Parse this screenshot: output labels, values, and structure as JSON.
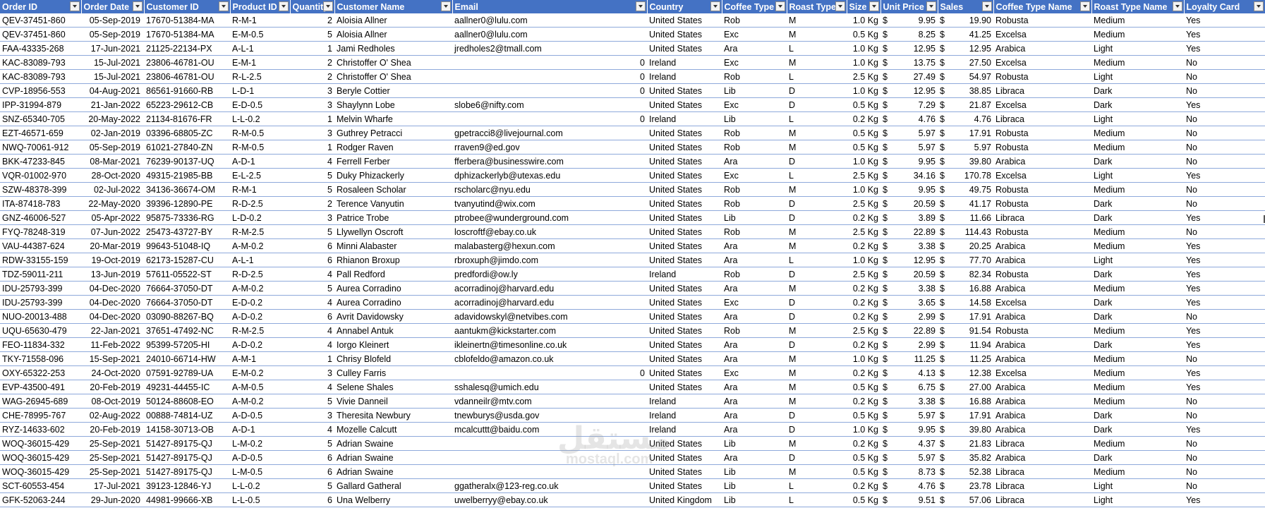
{
  "colors": {
    "header_bg": "#4472c4",
    "header_text": "#ffffff",
    "row_border": "#8ea9db"
  },
  "icons": {
    "filter": "filter-dropdown-icon"
  },
  "columns": [
    "Order ID",
    "Order Date",
    "Customer ID",
    "Product ID",
    "Quantity",
    "Customer Name",
    "Email",
    "Country",
    "Coffee Type",
    "Roast Type",
    "Size",
    "Unit Price",
    "Sales",
    "Coffee Type Name",
    "Roast Type Name",
    "Loyalty Card"
  ],
  "rows": [
    [
      "QEV-37451-860",
      "05-Sep-2019",
      "17670-51384-MA",
      "R-M-1",
      "2",
      "Aloisia Allner",
      "aallner0@lulu.com",
      "United States",
      "Rob",
      "M",
      "1.0 Kg",
      "9.95",
      "19.90",
      "Robusta",
      "Medium",
      "Yes"
    ],
    [
      "QEV-37451-860",
      "05-Sep-2019",
      "17670-51384-MA",
      "E-M-0.5",
      "5",
      "Aloisia Allner",
      "aallner0@lulu.com",
      "United States",
      "Exc",
      "M",
      "0.5 Kg",
      "8.25",
      "41.25",
      "Excelsa",
      "Medium",
      "Yes"
    ],
    [
      "FAA-43335-268",
      "17-Jun-2021",
      "21125-22134-PX",
      "A-L-1",
      "1",
      "Jami Redholes",
      "jredholes2@tmall.com",
      "United States",
      "Ara",
      "L",
      "1.0 Kg",
      "12.95",
      "12.95",
      "Arabica",
      "Light",
      "Yes"
    ],
    [
      "KAC-83089-793",
      "15-Jul-2021",
      "23806-46781-OU",
      "E-M-1",
      "2",
      "Christoffer O' Shea",
      "0",
      "Ireland",
      "Exc",
      "M",
      "1.0 Kg",
      "13.75",
      "27.50",
      "Excelsa",
      "Medium",
      "No"
    ],
    [
      "KAC-83089-793",
      "15-Jul-2021",
      "23806-46781-OU",
      "R-L-2.5",
      "2",
      "Christoffer O' Shea",
      "0",
      "Ireland",
      "Rob",
      "L",
      "2.5 Kg",
      "27.49",
      "54.97",
      "Robusta",
      "Light",
      "No"
    ],
    [
      "CVP-18956-553",
      "04-Aug-2021",
      "86561-91660-RB",
      "L-D-1",
      "3",
      "Beryle Cottier",
      "0",
      "United States",
      "Lib",
      "D",
      "1.0 Kg",
      "12.95",
      "38.85",
      "Libraca",
      "Dark",
      "No"
    ],
    [
      "IPP-31994-879",
      "21-Jan-2022",
      "65223-29612-CB",
      "E-D-0.5",
      "3",
      "Shaylynn Lobe",
      "slobe6@nifty.com",
      "United States",
      "Exc",
      "D",
      "0.5 Kg",
      "7.29",
      "21.87",
      "Excelsa",
      "Dark",
      "Yes"
    ],
    [
      "SNZ-65340-705",
      "20-May-2022",
      "21134-81676-FR",
      "L-L-0.2",
      "1",
      "Melvin Wharfe",
      "0",
      "Ireland",
      "Lib",
      "L",
      "0.2 Kg",
      "4.76",
      "4.76",
      "Libraca",
      "Light",
      "No"
    ],
    [
      "EZT-46571-659",
      "02-Jan-2019",
      "03396-68805-ZC",
      "R-M-0.5",
      "3",
      "Guthrey Petracci",
      "gpetracci8@livejournal.com",
      "United States",
      "Rob",
      "M",
      "0.5 Kg",
      "5.97",
      "17.91",
      "Robusta",
      "Medium",
      "No"
    ],
    [
      "NWQ-70061-912",
      "05-Sep-2019",
      "61021-27840-ZN",
      "R-M-0.5",
      "1",
      "Rodger Raven",
      "rraven9@ed.gov",
      "United States",
      "Rob",
      "M",
      "0.5 Kg",
      "5.97",
      "5.97",
      "Robusta",
      "Medium",
      "No"
    ],
    [
      "BKK-47233-845",
      "08-Mar-2021",
      "76239-90137-UQ",
      "A-D-1",
      "4",
      "Ferrell Ferber",
      "fferbera@businesswire.com",
      "United States",
      "Ara",
      "D",
      "1.0 Kg",
      "9.95",
      "39.80",
      "Arabica",
      "Dark",
      "No"
    ],
    [
      "VQR-01002-970",
      "28-Oct-2020",
      "49315-21985-BB",
      "E-L-2.5",
      "5",
      "Duky Phizackerly",
      "dphizackerlyb@utexas.edu",
      "United States",
      "Exc",
      "L",
      "2.5 Kg",
      "34.16",
      "170.78",
      "Excelsa",
      "Light",
      "Yes"
    ],
    [
      "SZW-48378-399",
      "02-Jul-2022",
      "34136-36674-OM",
      "R-M-1",
      "5",
      "Rosaleen Scholar",
      "rscholarc@nyu.edu",
      "United States",
      "Rob",
      "M",
      "1.0 Kg",
      "9.95",
      "49.75",
      "Robusta",
      "Medium",
      "No"
    ],
    [
      "ITA-87418-783",
      "22-May-2020",
      "39396-12890-PE",
      "R-D-2.5",
      "2",
      "Terence Vanyutin",
      "tvanyutind@wix.com",
      "United States",
      "Rob",
      "D",
      "2.5 Kg",
      "20.59",
      "41.17",
      "Robusta",
      "Dark",
      "No"
    ],
    [
      "GNZ-46006-527",
      "05-Apr-2022",
      "95875-73336-RG",
      "L-D-0.2",
      "3",
      "Patrice Trobe",
      "ptrobee@wunderground.com",
      "United States",
      "Lib",
      "D",
      "0.2 Kg",
      "3.89",
      "11.66",
      "Libraca",
      "Dark",
      "Yes"
    ],
    [
      "FYQ-78248-319",
      "07-Jun-2022",
      "25473-43727-BY",
      "R-M-2.5",
      "5",
      "Llywellyn Oscroft",
      "loscroftf@ebay.co.uk",
      "United States",
      "Rob",
      "M",
      "2.5 Kg",
      "22.89",
      "114.43",
      "Robusta",
      "Medium",
      "No"
    ],
    [
      "VAU-44387-624",
      "20-Mar-2019",
      "99643-51048-IQ",
      "A-M-0.2",
      "6",
      "Minni Alabaster",
      "malabasterg@hexun.com",
      "United States",
      "Ara",
      "M",
      "0.2 Kg",
      "3.38",
      "20.25",
      "Arabica",
      "Medium",
      "Yes"
    ],
    [
      "RDW-33155-159",
      "19-Oct-2019",
      "62173-15287-CU",
      "A-L-1",
      "6",
      "Rhianon Broxup",
      "rbroxuph@jimdo.com",
      "United States",
      "Ara",
      "L",
      "1.0 Kg",
      "12.95",
      "77.70",
      "Arabica",
      "Light",
      "Yes"
    ],
    [
      "TDZ-59011-211",
      "13-Jun-2019",
      "57611-05522-ST",
      "R-D-2.5",
      "4",
      "Pall Redford",
      "predfordi@ow.ly",
      "Ireland",
      "Rob",
      "D",
      "2.5 Kg",
      "20.59",
      "82.34",
      "Robusta",
      "Dark",
      "Yes"
    ],
    [
      "IDU-25793-399",
      "04-Dec-2020",
      "76664-37050-DT",
      "A-M-0.2",
      "5",
      "Aurea Corradino",
      "acorradinoj@harvard.edu",
      "United States",
      "Ara",
      "M",
      "0.2 Kg",
      "3.38",
      "16.88",
      "Arabica",
      "Medium",
      "Yes"
    ],
    [
      "IDU-25793-399",
      "04-Dec-2020",
      "76664-37050-DT",
      "E-D-0.2",
      "4",
      "Aurea Corradino",
      "acorradinoj@harvard.edu",
      "United States",
      "Exc",
      "D",
      "0.2 Kg",
      "3.65",
      "14.58",
      "Excelsa",
      "Dark",
      "Yes"
    ],
    [
      "NUO-20013-488",
      "04-Dec-2020",
      "03090-88267-BQ",
      "A-D-0.2",
      "6",
      "Avrit Davidowsky",
      "adavidowskyl@netvibes.com",
      "United States",
      "Ara",
      "D",
      "0.2 Kg",
      "2.99",
      "17.91",
      "Arabica",
      "Dark",
      "No"
    ],
    [
      "UQU-65630-479",
      "22-Jan-2021",
      "37651-47492-NC",
      "R-M-2.5",
      "4",
      "Annabel Antuk",
      "aantukm@kickstarter.com",
      "United States",
      "Rob",
      "M",
      "2.5 Kg",
      "22.89",
      "91.54",
      "Robusta",
      "Medium",
      "Yes"
    ],
    [
      "FEO-11834-332",
      "11-Feb-2022",
      "95399-57205-HI",
      "A-D-0.2",
      "4",
      "Iorgo Kleinert",
      "ikleinertn@timesonline.co.uk",
      "United States",
      "Ara",
      "D",
      "0.2 Kg",
      "2.99",
      "11.94",
      "Arabica",
      "Dark",
      "Yes"
    ],
    [
      "TKY-71558-096",
      "15-Sep-2021",
      "24010-66714-HW",
      "A-M-1",
      "1",
      "Chrisy Blofeld",
      "cblofeldo@amazon.co.uk",
      "United States",
      "Ara",
      "M",
      "1.0 Kg",
      "11.25",
      "11.25",
      "Arabica",
      "Medium",
      "No"
    ],
    [
      "OXY-65322-253",
      "24-Oct-2020",
      "07591-92789-UA",
      "E-M-0.2",
      "3",
      "Culley Farris",
      "0",
      "United States",
      "Exc",
      "M",
      "0.2 Kg",
      "4.13",
      "12.38",
      "Excelsa",
      "Medium",
      "Yes"
    ],
    [
      "EVP-43500-491",
      "20-Feb-2019",
      "49231-44455-IC",
      "A-M-0.5",
      "4",
      "Selene Shales",
      "sshalesq@umich.edu",
      "United States",
      "Ara",
      "M",
      "0.5 Kg",
      "6.75",
      "27.00",
      "Arabica",
      "Medium",
      "Yes"
    ],
    [
      "WAG-26945-689",
      "08-Oct-2019",
      "50124-88608-EO",
      "A-M-0.2",
      "5",
      "Vivie Danneil",
      "vdanneilr@mtv.com",
      "Ireland",
      "Ara",
      "M",
      "0.2 Kg",
      "3.38",
      "16.88",
      "Arabica",
      "Medium",
      "No"
    ],
    [
      "CHE-78995-767",
      "02-Aug-2022",
      "00888-74814-UZ",
      "A-D-0.5",
      "3",
      "Theresita Newbury",
      "tnewburys@usda.gov",
      "Ireland",
      "Ara",
      "D",
      "0.5 Kg",
      "5.97",
      "17.91",
      "Arabica",
      "Dark",
      "No"
    ],
    [
      "RYZ-14633-602",
      "20-Feb-2019",
      "14158-30713-OB",
      "A-D-1",
      "4",
      "Mozelle Calcutt",
      "mcalcuttt@baidu.com",
      "Ireland",
      "Ara",
      "D",
      "1.0 Kg",
      "9.95",
      "39.80",
      "Arabica",
      "Dark",
      "Yes"
    ],
    [
      "WOQ-36015-429",
      "25-Sep-2021",
      "51427-89175-QJ",
      "L-M-0.2",
      "5",
      "Adrian Swaine",
      "",
      "United States",
      "Lib",
      "M",
      "0.2 Kg",
      "4.37",
      "21.83",
      "Libraca",
      "Medium",
      "No"
    ],
    [
      "WOQ-36015-429",
      "25-Sep-2021",
      "51427-89175-QJ",
      "A-D-0.5",
      "6",
      "Adrian Swaine",
      "",
      "United States",
      "Ara",
      "D",
      "0.5 Kg",
      "5.97",
      "35.82",
      "Arabica",
      "Dark",
      "No"
    ],
    [
      "WOQ-36015-429",
      "25-Sep-2021",
      "51427-89175-QJ",
      "L-M-0.5",
      "6",
      "Adrian Swaine",
      "",
      "United States",
      "Lib",
      "M",
      "0.5 Kg",
      "8.73",
      "52.38",
      "Libraca",
      "Medium",
      "No"
    ],
    [
      "SCT-60553-454",
      "17-Jul-2021",
      "39123-12846-YJ",
      "L-L-0.2",
      "5",
      "Gallard Gatheral",
      "ggatheralx@123-reg.co.uk",
      "United States",
      "Lib",
      "L",
      "0.2 Kg",
      "4.76",
      "23.78",
      "Libraca",
      "Light",
      "No"
    ],
    [
      "GFK-52063-244",
      "29-Jun-2020",
      "44981-99666-XB",
      "L-L-0.5",
      "6",
      "Una Welberry",
      "uwelberryy@ebay.co.uk",
      "United Kingdom",
      "Lib",
      "L",
      "0.5 Kg",
      "9.51",
      "57.06",
      "Libraca",
      "Light",
      "Yes"
    ]
  ],
  "currency_symbol": "$",
  "watermark": {
    "arabic": "مستقل",
    "latin": "mostaql.com"
  }
}
